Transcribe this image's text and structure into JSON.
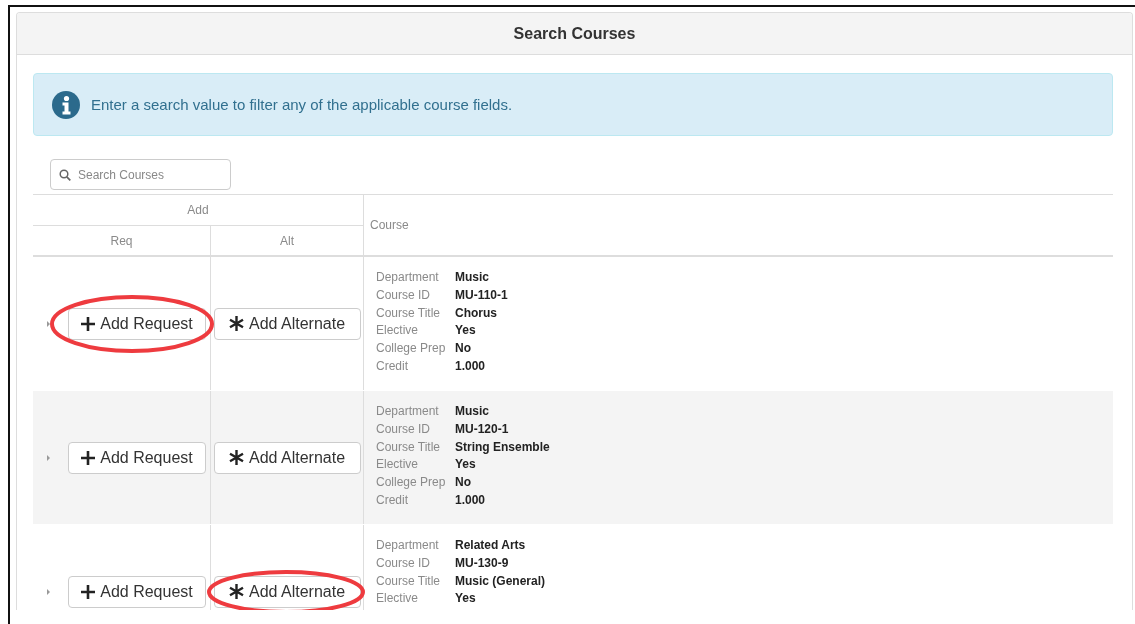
{
  "panel": {
    "title": "Search Courses"
  },
  "alert": {
    "text": "Enter a search value to filter any of the applicable course fields."
  },
  "search": {
    "placeholder": "Search Courses"
  },
  "table": {
    "group_header": "Add",
    "columns": [
      "Req",
      "Alt",
      "Course"
    ],
    "rows": [
      {
        "request_button": "Add Request",
        "request_highlighted": true,
        "alternate_button": "Add Alternate",
        "alternate_highlighted": false,
        "fields": [
          {
            "label": "Department",
            "value": "Music"
          },
          {
            "label": "Course ID",
            "value": "MU-110-1"
          },
          {
            "label": "Course Title",
            "value": "Chorus"
          },
          {
            "label": "Elective",
            "value": "Yes"
          },
          {
            "label": "College Prep",
            "value": "No"
          },
          {
            "label": "Credit",
            "value": "1.000"
          }
        ]
      },
      {
        "request_button": "Add Request",
        "request_highlighted": false,
        "alternate_button": "Add Alternate",
        "alternate_highlighted": false,
        "fields": [
          {
            "label": "Department",
            "value": "Music"
          },
          {
            "label": "Course ID",
            "value": "MU-120-1"
          },
          {
            "label": "Course Title",
            "value": "String Ensemble"
          },
          {
            "label": "Elective",
            "value": "Yes"
          },
          {
            "label": "College Prep",
            "value": "No"
          },
          {
            "label": "Credit",
            "value": "1.000"
          }
        ]
      },
      {
        "request_button": "Add Request",
        "request_highlighted": false,
        "alternate_button": "Add Alternate",
        "alternate_highlighted": true,
        "fields": [
          {
            "label": "Department",
            "value": "Related Arts"
          },
          {
            "label": "Course ID",
            "value": "MU-130-9"
          },
          {
            "label": "Course Title",
            "value": "Music (General)"
          },
          {
            "label": "Elective",
            "value": "Yes"
          }
        ]
      }
    ]
  }
}
